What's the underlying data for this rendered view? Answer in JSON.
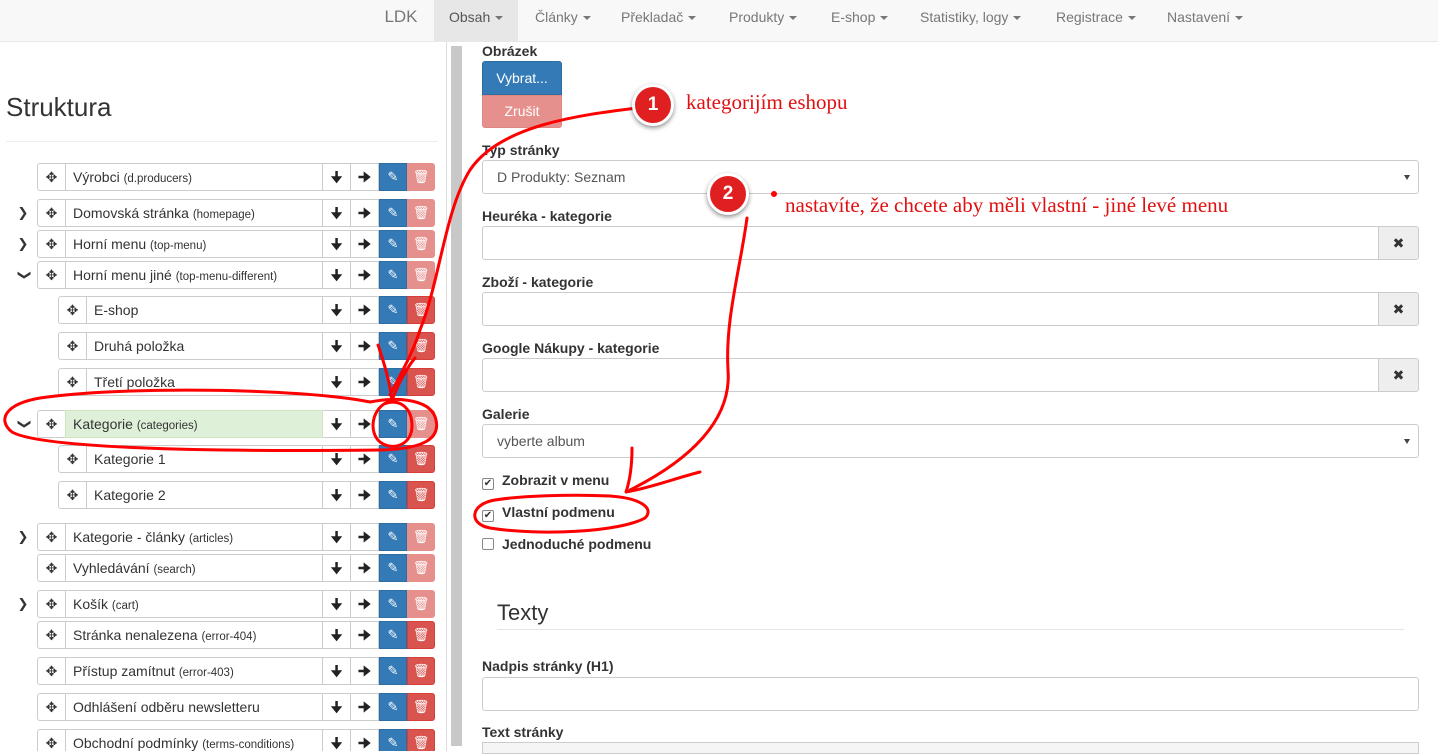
{
  "navbar": {
    "brand": "LDK",
    "items": [
      {
        "label": "Obsah"
      },
      {
        "label": "Články"
      },
      {
        "label": "Překladač"
      },
      {
        "label": "Produkty"
      },
      {
        "label": "E-shop"
      },
      {
        "label": "Statistiky, logy"
      },
      {
        "label": "Registrace"
      },
      {
        "label": "Nastavení"
      }
    ]
  },
  "structure": {
    "title": "Struktura",
    "rows": [
      {
        "label": "Výrobci",
        "tag": "(d.producers)"
      },
      {
        "label": "Domovská stránka",
        "tag": "(homepage)"
      },
      {
        "label": "Horní menu",
        "tag": "(top-menu)"
      },
      {
        "label": "Horní menu jiné",
        "tag": "(top-menu-different)"
      },
      {
        "label": "E-shop",
        "tag": ""
      },
      {
        "label": "Druhá položka",
        "tag": ""
      },
      {
        "label": "Třetí položka",
        "tag": ""
      },
      {
        "label": "Kategorie",
        "tag": "(categories)"
      },
      {
        "label": "Kategorie 1",
        "tag": ""
      },
      {
        "label": "Kategorie 2",
        "tag": ""
      },
      {
        "label": "Kategorie - články",
        "tag": "(articles)"
      },
      {
        "label": "Vyhledávání",
        "tag": "(search)"
      },
      {
        "label": "Košík",
        "tag": "(cart)"
      },
      {
        "label": "Stránka nenalezena",
        "tag": "(error-404)"
      },
      {
        "label": "Přístup zamítnut",
        "tag": "(error-403)"
      },
      {
        "label": "Odhlášení odběru newsletteru",
        "tag": ""
      },
      {
        "label": "Obchodní podmínky",
        "tag": "(terms-conditions)"
      }
    ]
  },
  "form": {
    "image_label": "Obrázek",
    "choose_button": "Vybrat...",
    "cancel_button": "Zrušit",
    "page_type_label": "Typ stránky",
    "page_type_value": "D Produkty: Seznam",
    "heureka_label": "Heuréka - kategorie",
    "zbozi_label": "Zboží - kategorie",
    "google_label": "Google Nákupy - kategorie",
    "gallery_label": "Galerie",
    "gallery_value": "vyberte album",
    "show_in_menu_label": "Zobrazit v menu",
    "custom_submenu_label": "Vlastní podmenu",
    "simple_submenu_label": "Jednoduché podmenu",
    "texts_heading": "Texty",
    "h1_label": "Nadpis stránky (H1)",
    "page_text_label": "Text stránky"
  },
  "annotations": {
    "badge1": "1",
    "text1": "kategorijím eshopu",
    "badge2": "2",
    "text2": "nastavíte, že chcete aby měli vlastní - jiné levé menu"
  },
  "colors": {
    "annotation_red": "#e01010",
    "primary_blue": "#337ab7",
    "danger_red": "#d9534f",
    "selected_green": "#dff0d8"
  }
}
